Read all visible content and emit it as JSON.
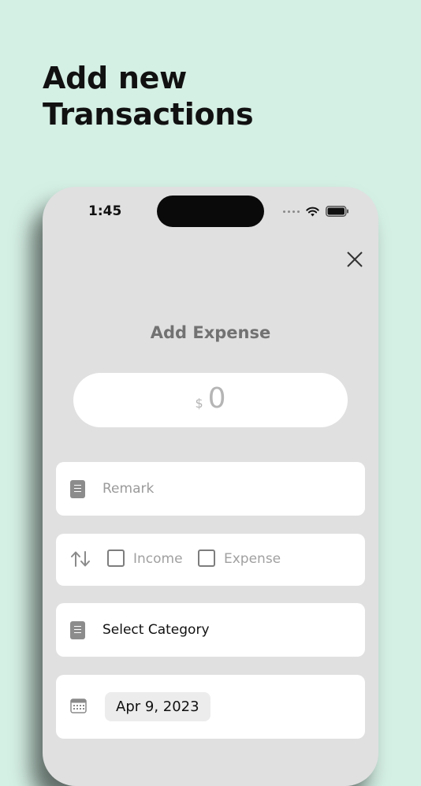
{
  "promo": {
    "headline_line1": "Add new",
    "headline_line2": "Transactions"
  },
  "status_bar": {
    "time": "1:45",
    "icons": [
      "signal-dots-icon",
      "wifi-icon",
      "battery-icon"
    ]
  },
  "modal": {
    "title": "Add Expense",
    "close_icon": "close-icon"
  },
  "amount": {
    "currency_symbol": "$",
    "value": "0"
  },
  "remark": {
    "icon": "document-icon",
    "placeholder": "Remark"
  },
  "transaction_type": {
    "icon": "swap-arrows-icon",
    "options": [
      {
        "label": "Income",
        "checked": false
      },
      {
        "label": "Expense",
        "checked": false
      }
    ]
  },
  "category": {
    "icon": "document-icon",
    "label": "Select Category"
  },
  "date": {
    "icon": "calendar-icon",
    "value": "Apr 9, 2023"
  },
  "colors": {
    "background": "#d4efe4",
    "phone_surface": "#e0e0e0",
    "field": "#ffffff",
    "muted_text": "#9a9a9a",
    "icon_gray": "#8c8c8c"
  }
}
